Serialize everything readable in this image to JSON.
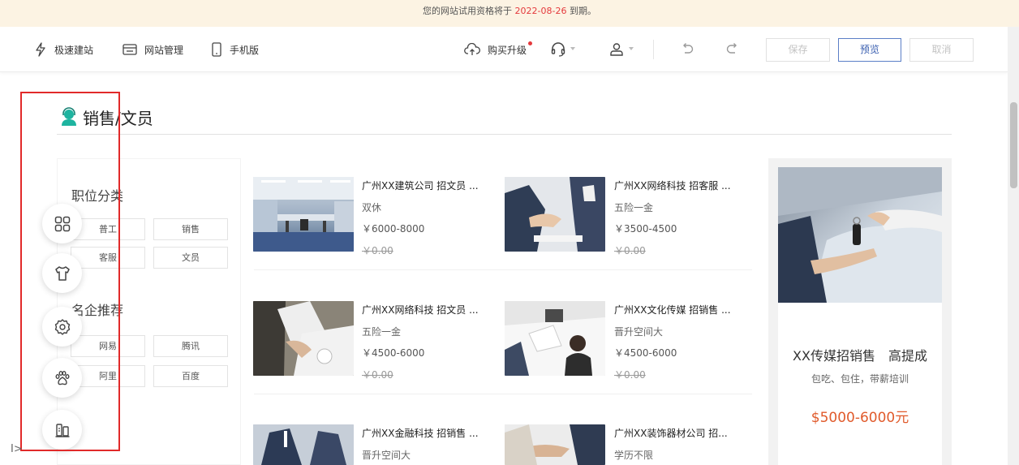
{
  "notice": {
    "prefix": "您的网站试用资格将于",
    "date": "2022-08-26",
    "suffix": "到期。"
  },
  "toolbar": {
    "quick_build": "极速建站",
    "site_manage": "网站管理",
    "mobile": "手机版",
    "upgrade": "购买升级",
    "save": "保存",
    "preview": "预览",
    "cancel": "取消"
  },
  "section": {
    "title": "销售/文员"
  },
  "categories": {
    "title": "职位分类",
    "tags": [
      "普工",
      "销售",
      "客服",
      "文员"
    ]
  },
  "companies": {
    "title": "名企推荐",
    "tags": [
      "网易",
      "腾讯",
      "阿里",
      "百度"
    ]
  },
  "jobs": [
    {
      "title": "广州XX建筑公司 招文员 ...",
      "benefit": "双休",
      "salary": "￥6000-8000",
      "old": "￥0.00"
    },
    {
      "title": "广州XX网络科技 招客服 ...",
      "benefit": "五险一金",
      "salary": "￥3500-4500",
      "old": "￥0.00"
    },
    {
      "title": "广州XX网络科技 招文员 ...",
      "benefit": "五险一金",
      "salary": "￥4500-6000",
      "old": "￥0.00"
    },
    {
      "title": "广州XX文化传媒 招销售 ...",
      "benefit": "晋升空间大",
      "salary": "￥4500-6000",
      "old": "￥0.00"
    },
    {
      "title": "广州XX金融科技 招销售 ...",
      "benefit": "晋升空间大"
    },
    {
      "title": "广州XX装饰器材公司 招...",
      "benefit": "学历不限"
    }
  ],
  "promo": {
    "title": "XX传媒招销售　高提成",
    "subtitle": "包吃、包住，带薪培训",
    "price": "$5000-6000元"
  },
  "collapse": "I>",
  "colors": {
    "accent": "#3a5fb0",
    "highlight_box": "#e12a2a",
    "price": "#e05a2b",
    "icon_teal": "#1eb4a0"
  },
  "icons": [
    "bolt-icon",
    "window-icon",
    "phone-icon",
    "cloud-upload-icon",
    "headset-icon",
    "user-icon",
    "undo-icon",
    "redo-icon",
    "grid-icon",
    "shirt-icon",
    "gear-icon",
    "paw-icon",
    "building-icon"
  ]
}
